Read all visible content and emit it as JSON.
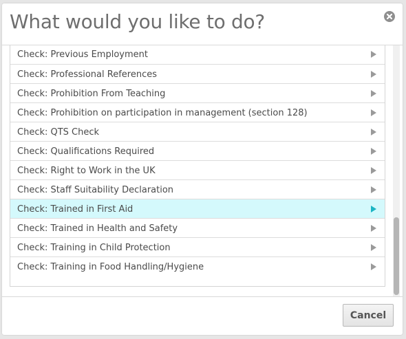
{
  "dialog": {
    "title": "What would you like to do?",
    "close_icon": "close-circle-icon",
    "cancel_label": "Cancel"
  },
  "colors": {
    "selected_row_bg": "#d4f9fc",
    "selected_arrow": "#1bb5c4",
    "arrow": "#9a9a9a",
    "text": "#4a4a4a"
  },
  "list": {
    "items": [
      {
        "label": "Check: Previous Employment",
        "selected": false
      },
      {
        "label": "Check: Professional References",
        "selected": false
      },
      {
        "label": "Check: Prohibition From Teaching",
        "selected": false
      },
      {
        "label": "Check: Prohibition on participation in management (section 128)",
        "selected": false
      },
      {
        "label": "Check: QTS Check",
        "selected": false
      },
      {
        "label": "Check: Qualifications Required",
        "selected": false
      },
      {
        "label": "Check: Right to Work in the UK",
        "selected": false
      },
      {
        "label": "Check: Staff Suitability Declaration",
        "selected": false
      },
      {
        "label": "Check: Trained in First Aid",
        "selected": true
      },
      {
        "label": "Check: Trained in Health and Safety",
        "selected": false
      },
      {
        "label": "Check: Training in Child Protection",
        "selected": false
      },
      {
        "label": "Check: Training in Food Handling/Hygiene",
        "selected": false
      }
    ]
  }
}
